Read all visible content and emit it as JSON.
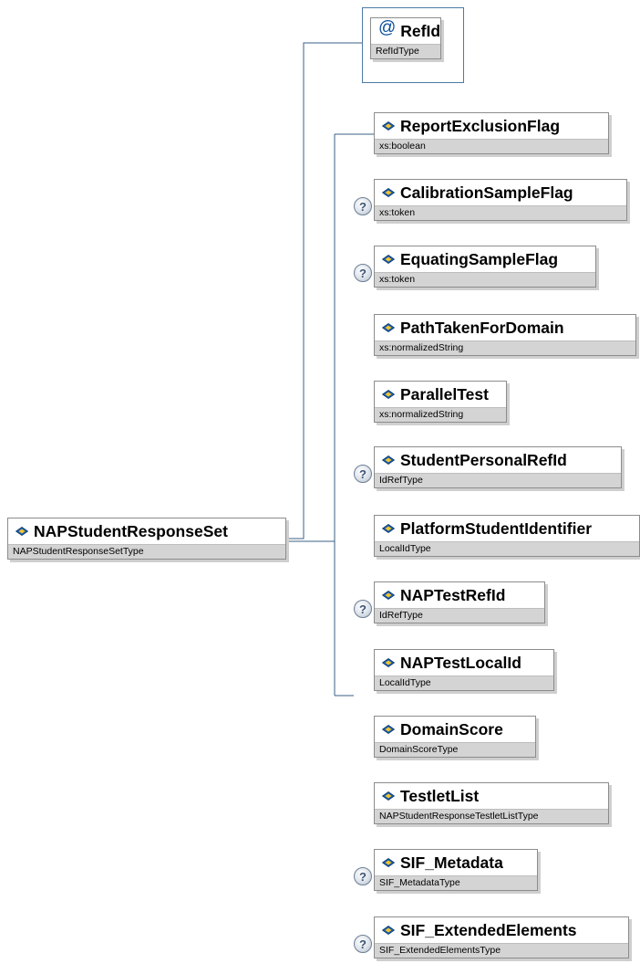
{
  "root": {
    "name": "NAPStudentResponseSet",
    "type": "NAPStudentResponseSetType"
  },
  "attribute": {
    "symbol": "@",
    "name": "RefId",
    "type": "RefIdType"
  },
  "optional_marker": "?",
  "icons": {
    "element": "element-diamond-icon",
    "attribute": "at-sign-icon",
    "optional": "question-circle-icon"
  },
  "colors": {
    "connector": "#3a5f86",
    "type_bar": "#d4d4d4",
    "border": "#8c8c8c",
    "attr_frame": "#4d7aa6"
  },
  "elements": [
    {
      "name": "ReportExclusionFlag",
      "type": "xs:boolean",
      "optional": false
    },
    {
      "name": "CalibrationSampleFlag",
      "type": "xs:token",
      "optional": true
    },
    {
      "name": "EquatingSampleFlag",
      "type": "xs:token",
      "optional": true
    },
    {
      "name": "PathTakenForDomain",
      "type": "xs:normalizedString",
      "optional": false
    },
    {
      "name": "ParallelTest",
      "type": "xs:normalizedString",
      "optional": false
    },
    {
      "name": "StudentPersonalRefId",
      "type": "IdRefType",
      "optional": true
    },
    {
      "name": "PlatformStudentIdentifier",
      "type": "LocalIdType",
      "optional": false
    },
    {
      "name": "NAPTestRefId",
      "type": "IdRefType",
      "optional": true
    },
    {
      "name": "NAPTestLocalId",
      "type": "LocalIdType",
      "optional": false
    },
    {
      "name": "DomainScore",
      "type": "DomainScoreType",
      "optional": false
    },
    {
      "name": "TestletList",
      "type": "NAPStudentResponseTestletListType",
      "optional": false
    },
    {
      "name": "SIF_Metadata",
      "type": "SIF_MetadataType",
      "optional": true
    },
    {
      "name": "SIF_ExtendedElements",
      "type": "SIF_ExtendedElementsType",
      "optional": true
    }
  ]
}
